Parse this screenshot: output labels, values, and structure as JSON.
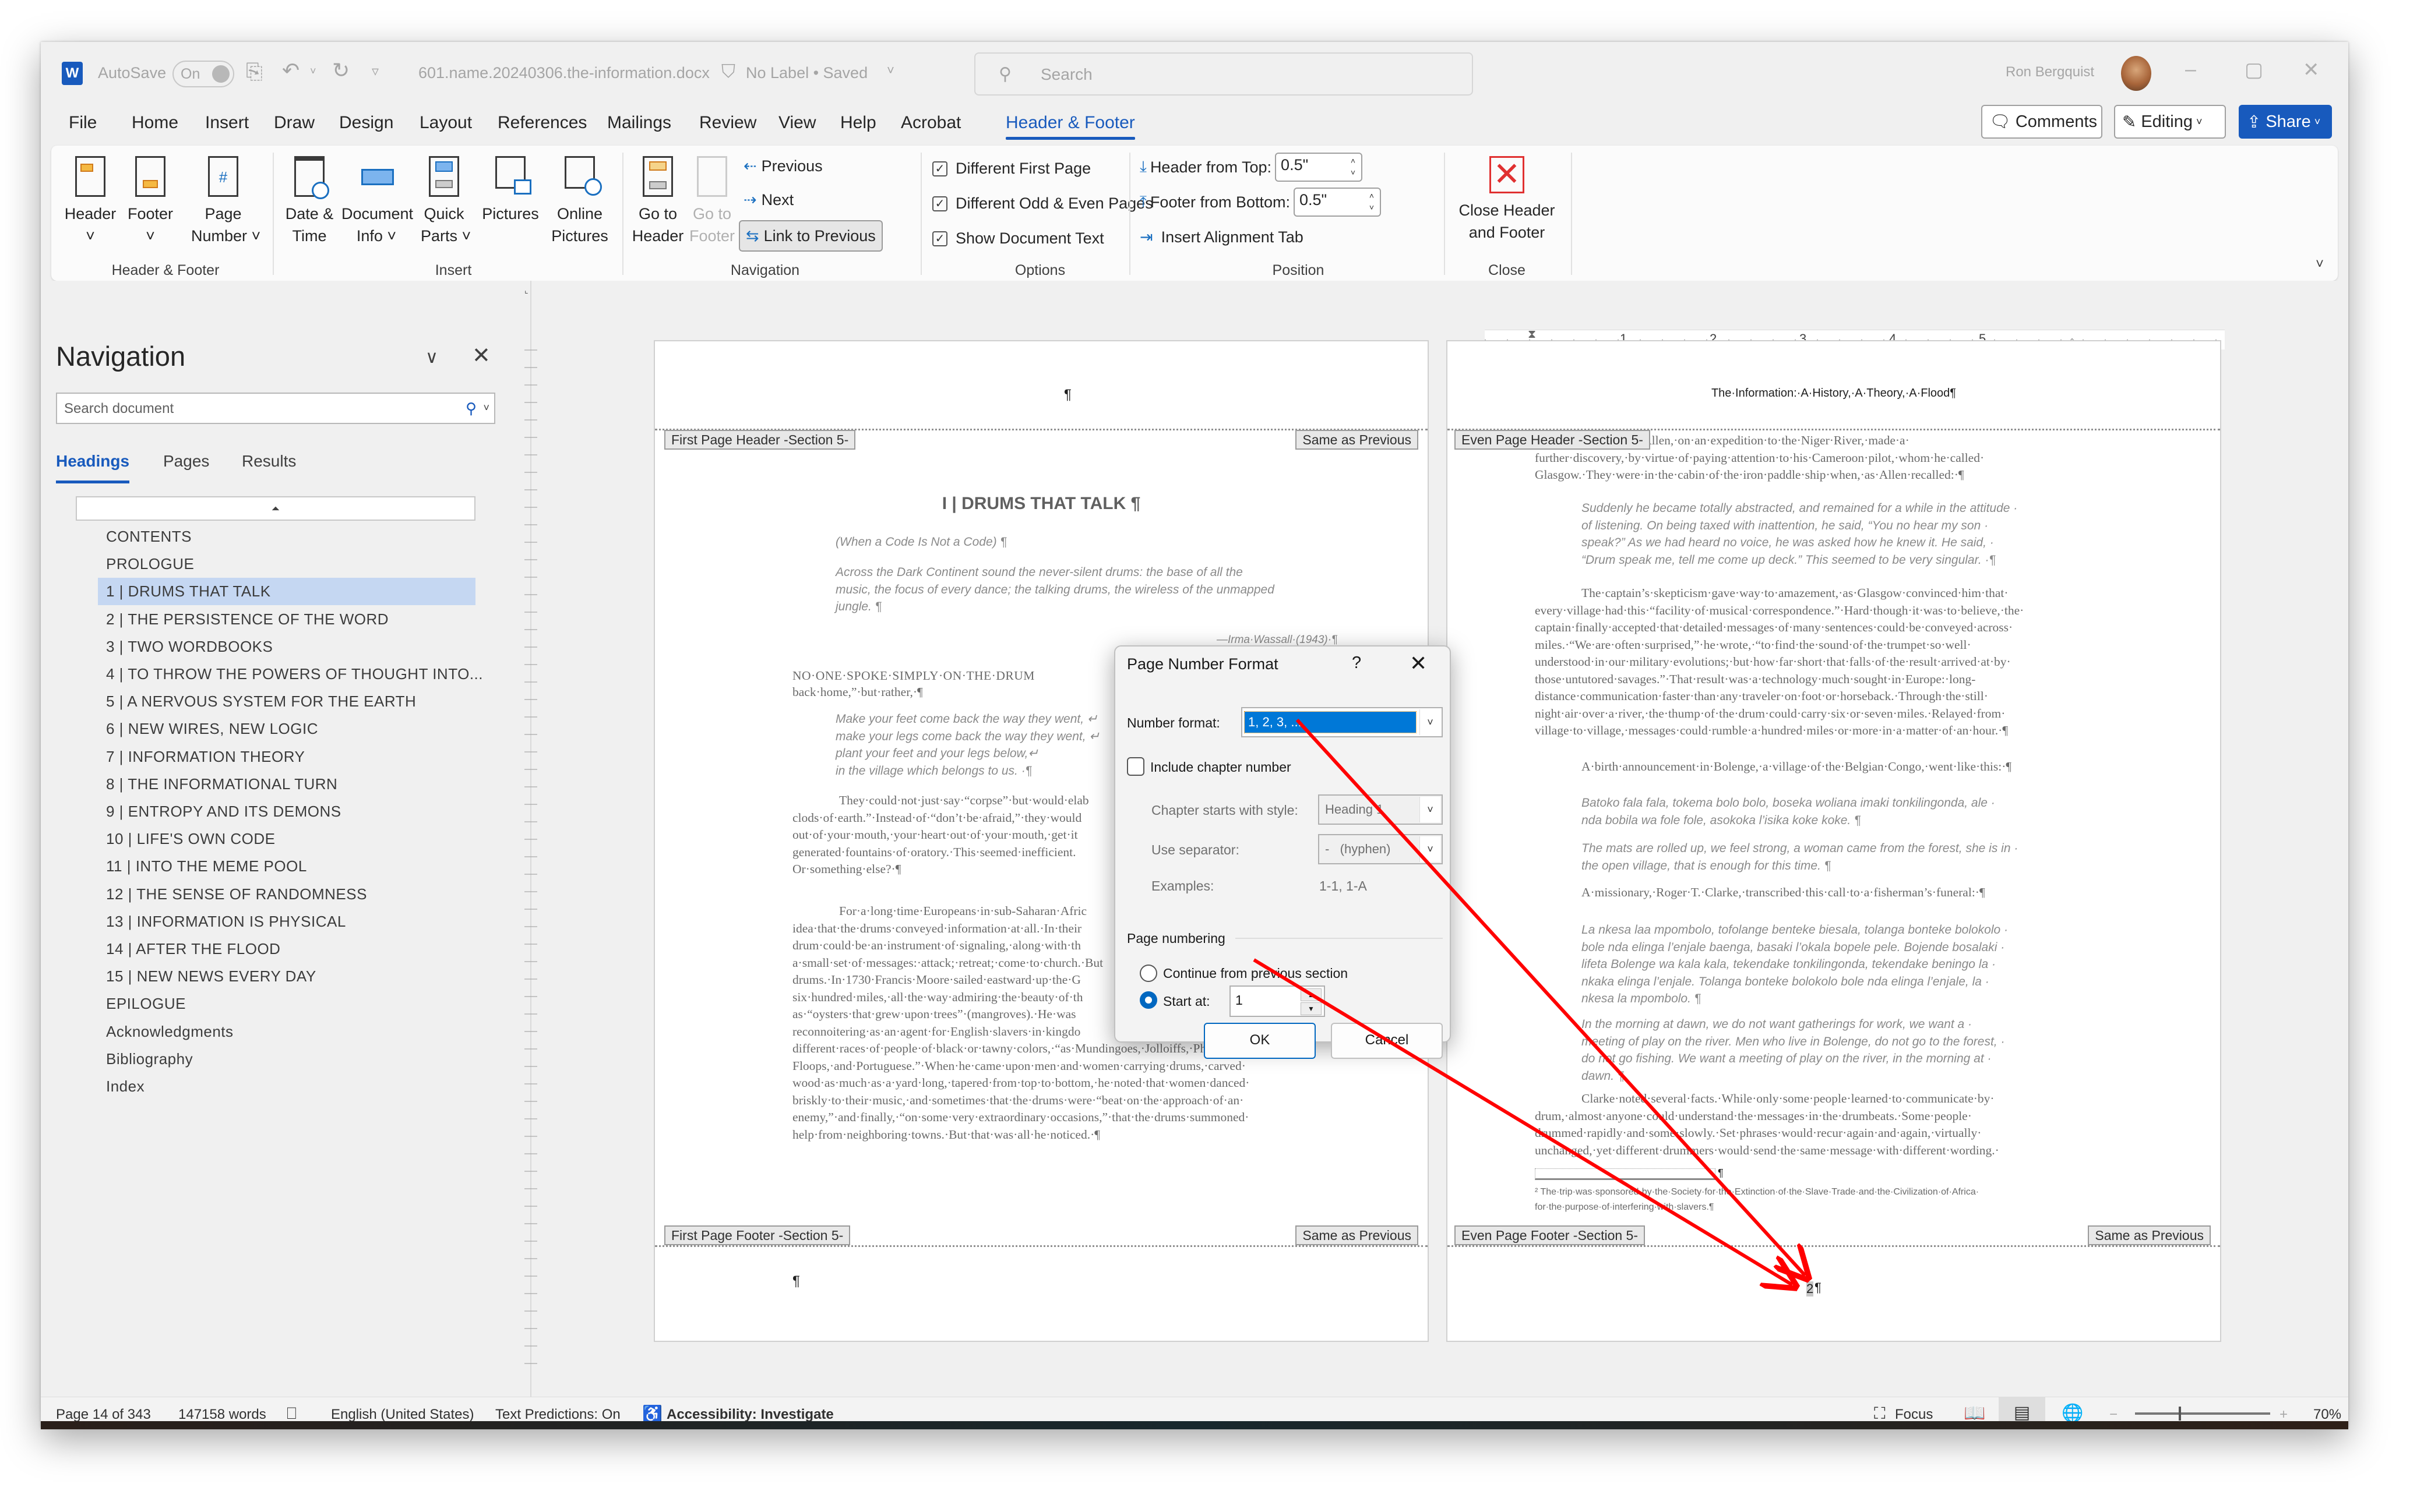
{
  "titlebar": {
    "app_icon": "word-icon",
    "autosave_label": "AutoSave",
    "autosave_state": "On",
    "filename": "601.name.20240306.the-information.docx",
    "label_status": "No Label • Saved",
    "search_placeholder": "Search",
    "user_name": "Ron Bergquist",
    "minimize": "–",
    "restore": "▢",
    "close": "✕"
  },
  "menu": {
    "tabs": [
      "File",
      "Home",
      "Insert",
      "Draw",
      "Design",
      "Layout",
      "References",
      "Mailings",
      "Review",
      "View",
      "Help",
      "Acrobat",
      "Header & Footer"
    ],
    "active_tab": "Header & Footer",
    "comments": "Comments",
    "editing": "Editing",
    "share": "Share"
  },
  "ribbon": {
    "groups": {
      "header_footer": {
        "label": "Header & Footer",
        "header": [
          "Header",
          "˅"
        ],
        "footer": [
          "Footer",
          "˅"
        ],
        "page_number": [
          "Page",
          "Number ˅"
        ]
      },
      "insert": {
        "label": "Insert",
        "date_time": [
          "Date &",
          "Time"
        ],
        "document_info": [
          "Document",
          "Info ˅"
        ],
        "quick_parts": [
          "Quick",
          "Parts ˅"
        ],
        "pictures": [
          "Pictures",
          ""
        ],
        "online_pictures": [
          "Online",
          "Pictures"
        ]
      },
      "navigation": {
        "label": "Navigation",
        "go_to_header": [
          "Go to",
          "Header"
        ],
        "go_to_footer": [
          "Go to",
          "Footer"
        ],
        "previous": "Previous",
        "next": "Next",
        "link_to_previous": "Link to Previous"
      },
      "options": {
        "label": "Options",
        "different_first_page": "Different First Page",
        "different_odd_even": "Different Odd & Even Pages",
        "show_document_text": "Show Document Text",
        "checked": [
          true,
          true,
          true
        ]
      },
      "position": {
        "label": "Position",
        "header_from_top_label": "Header from Top:",
        "header_from_top_value": "0.5\"",
        "footer_from_bottom_label": "Footer from Bottom:",
        "footer_from_bottom_value": "0.5\"",
        "insert_alignment_tab": "Insert Alignment Tab"
      },
      "close": {
        "label": "Close",
        "close_header_footer": [
          "Close Header",
          "and Footer"
        ]
      }
    }
  },
  "navigation_pane": {
    "title": "Navigation",
    "search_placeholder": "Search document",
    "tabs": [
      "Headings",
      "Pages",
      "Results"
    ],
    "active_tab": "Headings",
    "headings": [
      "CONTENTS",
      "PROLOGUE",
      "1 | DRUMS THAT TALK",
      "2 | THE PERSISTENCE OF THE WORD",
      "3 | TWO WORDBOOKS",
      "4 | TO THROW THE POWERS OF THOUGHT INTO...",
      "5 | A NERVOUS SYSTEM FOR THE EARTH",
      "6 | NEW WIRES, NEW LOGIC",
      "7 | INFORMATION THEORY",
      "8 | THE INFORMATIONAL TURN",
      "9 | ENTROPY AND ITS DEMONS",
      "10 | LIFE'S OWN CODE",
      "11 | INTO THE MEME POOL",
      "12 | THE SENSE OF RANDOMNESS",
      "13 | INFORMATION IS PHYSICAL",
      "14 | AFTER THE FLOOD",
      "15 | NEW NEWS EVERY DAY",
      "EPILOGUE",
      "Acknowledgments",
      "Bibliography",
      "Index"
    ],
    "selected_heading": "1 | DRUMS THAT TALK"
  },
  "ruler": {
    "numbers": [
      "1",
      "2",
      "3",
      "4",
      "5"
    ]
  },
  "left_page": {
    "header_tag": "First Page Header -Section 5-",
    "header_link": "Same as Previous",
    "header_text": "¶",
    "chapter_title": "I | DRUMS THAT TALK ¶",
    "subtitle": "(When a Code Is Not a Code) ¶",
    "epigraph": "Across the Dark Continent sound the never-silent drums: the base of all the music, the focus of every dance; the talking drums, the wireless of the unmapped jungle. ¶",
    "epigraph_attribution": "—Irma·Wassall·(1943)·¶",
    "para1": "NO·ONE·SPOKE·SIMPLY·ON·THE·DRUM",
    "para1_cont": "back·home,”·but·rather,·¶",
    "verse": [
      "Make your feet come back the way they went, ↵",
      "make your legs come back the way they went, ↵",
      "plant your feet and your legs below,↵",
      "in the village which belongs to us. ·¶"
    ],
    "para2": [
      "They·could·not·just·say·“corpse”·but·would·elab",
      "clods·of·earth.”·Instead·of·“don’t·be·afraid,”·they·would",
      "out·of·your·mouth,·your·heart·out·of·your·mouth,·get·it",
      "generated·fountains·of·oratory.·This·seemed·inefficient.",
      "Or·something·else?·¶"
    ],
    "para3": [
      "For·a·long·time·Europeans·in·sub-Saharan·Afric",
      "idea·that·the·drums·conveyed·information·at·all.·In·their",
      "drum·could·be·an·instrument·of·signaling,·along·with·th",
      "a·small·set·of·messages:·attack;·retreat;·come·to·church.·But",
      "drums.·In·1730·Francis·Moore·sailed·eastward·up·the·G",
      "six·hundred·miles,·all·the·way·admiring·the·beauty·of·th",
      "as·“oysters·that·grew·upon·trees”·(mangroves).·He·was",
      "reconnoitering·as·an·agent·for·English·slavers·in·kingdo",
      "different·races·of·people·of·black·or·tawny·colors,·“as·Mundingoes,·Jolloiffs,·Pholeys,·",
      "Floops,·and·Portuguese.”·When·he·came·upon·men·and·women·carrying·drums,·carved·",
      "wood·as·much·as·a·yard·long,·tapered·from·top·to·bottom,·he·noted·that·women·danced·",
      "briskly·to·their·music,·and·sometimes·that·the·drums·were·“beat·on·the·approach·of·an·",
      "enemy,”·and·finally,·“on·some·very·extraordinary·occasions,”·that·the·drums·summoned·",
      "help·from·neighboring·towns.·But·that·was·all·he·noticed.·¶"
    ],
    "footer_tag": "First Page Footer -Section 5-",
    "footer_link": "Same as Previous",
    "footer_text": "¶"
  },
  "right_page": {
    "header_text": "The·Information:·A·History,·A·Theory,·A·Flood¶",
    "header_tag": "Even Page Header -Section 5-",
    "para1": [
      "ter,·Captain·William·Allen,·on·an·expedition·to·the·Niger·River,·made·a·",
      "further·discovery,·by·virtue·of·paying·attention·to·his·Cameroon·pilot,·whom·he·called·",
      "Glasgow.·They·were·in·the·cabin·of·the·iron·paddle·ship·when,·as·Allen·recalled:·¶"
    ],
    "quote1": [
      "Suddenly he became totally abstracted, and remained for a while in the attitude ·",
      "of listening. On being taxed with inattention, he said, “You no hear my son ·",
      "speak?” As we had heard no voice, he was asked how he knew it. He said, ·",
      "“Drum speak me, tell me come up deck.” This seemed to be very singular. ·¶"
    ],
    "para2": [
      "The·captain’s·skepticism·gave·way·to·amazement,·as·Glasgow·convinced·him·that·",
      "every·village·had·this·“facility·of·musical·correspondence.”·Hard·though·it·was·to·believe,·the·",
      "captain·finally·accepted·that·detailed·messages·of·many·sentences·could·be·conveyed·across·",
      "miles.·“We·are·often·surprised,”·he·wrote,·“to·find·the·sound·of·the·trumpet·so·well·",
      "understood·in·our·military·evolutions;·but·how·far·short·that·falls·of·the·result·arrived·at·by·",
      "those·untutored·savages.”·That·result·was·a·technology·much·sought·in·Europe:·long-",
      "distance·communication·faster·than·any·traveler·on·foot·or·horseback.·Through·the·still·",
      "night·air·over·a·river,·the·thump·of·the·drum·could·carry·six·or·seven·miles.·Relayed·from·",
      "village·to·village,·messages·could·rumble·a·hundred·miles·or·more·in·a·matter·of·an·hour.·¶"
    ],
    "para3": "A·birth·announcement·in·Bolenge,·a·village·of·the·Belgian·Congo,·went·like·this:·¶",
    "quote2": [
      "Batoko fala fala, tokema bolo bolo, boseka woliana imaki tonkilingonda, ale ·",
      "nda bobila wa fole fole, asokoka l’isika koke koke. ¶"
    ],
    "quote3": [
      "The mats are rolled up, we feel strong, a woman came from the forest, she is in ·",
      "the open village, that is enough for this time. ¶"
    ],
    "para4": "A·missionary,·Roger·T.·Clarke,·transcribed·this·call·to·a·fisherman’s·funeral:·¶",
    "quote4": [
      "La nkesa laa mpombolo, tofolange benteke biesala, tolanga bonteke bolokolo ·",
      "bole nda elinga l’enjale baenga, basaki l’okala bopele pele. Bojende bosalaki ·",
      "lifeta Bolenge wa kala kala, tekendake tonkilingonda, tekendake beningo la ·",
      "nkaka elinga l’enjale. Tolanga bonteke bolokolo bole nda elinga l’enjale, la ·",
      "nkesa la mpombolo. ¶"
    ],
    "quote5": [
      "In the morning at dawn, we do not want gatherings for work, we want a ·",
      "meeting of play on the river. Men who live in Bolenge, do not go to the forest, ·",
      "do not go fishing. We want a meeting of play on the river, in the morning at ·",
      "dawn. ¶"
    ],
    "para5": [
      "Clarke·noted·several·facts.·While·only·some·people·learned·to·communicate·by·",
      "drum,·almost·anyone·could·understand·the·messages·in·the·drumbeats.·Some·people·",
      "drummed·rapidly·and·some·slowly.·Set·phrases·would·recur·again·and·again,·virtually·",
      "unchanged,·yet·different·drummers·would·send·the·same·message·with·different·wording.·"
    ],
    "footnote_sep": "¶",
    "footnote": [
      "² The·trip·was·sponsored·by·the·Society·for·the·Extinction·of·the·Slave·Trade·and·the·Civilization·of·Africa·",
      "for·the·purpose·of·interfering·with·slavers.¶"
    ],
    "footer_tag": "Even Page Footer -Section 5-",
    "footer_link": "Same as Previous",
    "footer_page_number": "2",
    "footer_pilcrow": "¶"
  },
  "dialog": {
    "title": "Page Number Format",
    "help": "?",
    "close": "✕",
    "number_format_label": "Number format:",
    "number_format_value": "1, 2, 3, ...",
    "include_chapter_number_label": "Include chapter number",
    "include_chapter_number_checked": false,
    "chapter_style_label": "Chapter starts with style:",
    "chapter_style_value": "Heading 1",
    "separator_label": "Use separator:",
    "separator_value": "-   (hyphen)",
    "examples_label": "Examples:",
    "examples_value": "1-1, 1-A",
    "page_numbering_label": "Page numbering",
    "continue_label": "Continue from previous section",
    "start_at_label": "Start at:",
    "start_at_value": "1",
    "selected_option": "start_at",
    "ok": "OK",
    "cancel": "Cancel"
  },
  "statusbar": {
    "page": "Page 14 of 343",
    "words": "147158 words",
    "language": "English (United States)",
    "text_predictions": "Text Predictions: On",
    "accessibility": "Accessibility: Investigate",
    "focus": "Focus",
    "zoom_level": "70%",
    "zoom_percent": 70
  },
  "annotation": {
    "arrow_color": "#ff0000"
  }
}
